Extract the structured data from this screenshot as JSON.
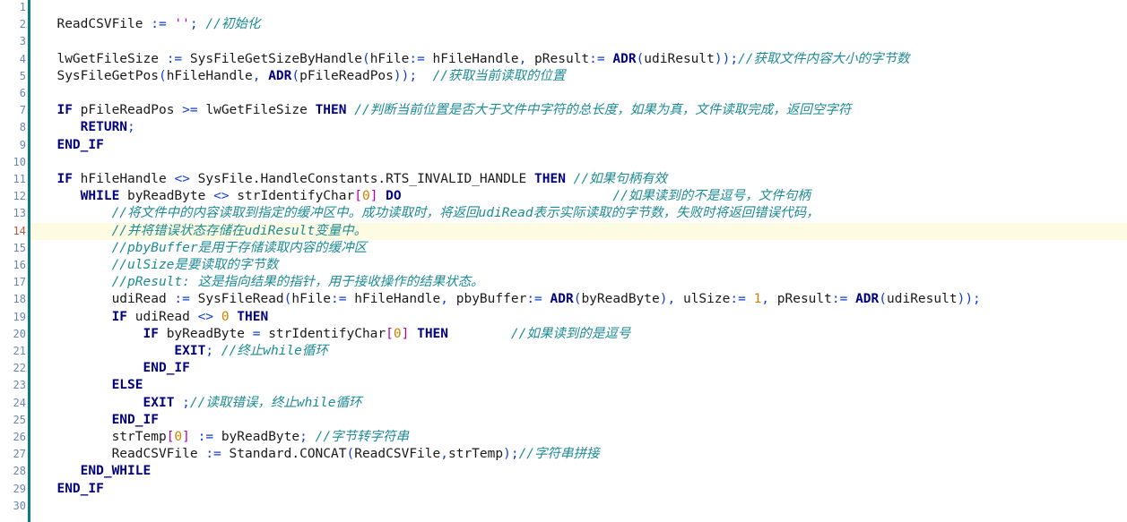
{
  "editor": {
    "title": "structured-text-code-editor",
    "language": "Structured Text (IEC 61131-3)",
    "current_line": 14,
    "first_visible_line": 1,
    "last_visible_line": 30,
    "colors": {
      "background": "#ffffff",
      "gutter_divider": "#0d7b80",
      "gutter_number": "#6b86b0",
      "gutter_number_current": "#b05a3c",
      "current_line_highlight": "#fdfbe2",
      "keyword": "#00007f",
      "comment": "#1d8a93",
      "operator": "#0f3fd0",
      "string": "#b000b0",
      "number": "#d08000",
      "bracket": "#b000b0",
      "identifier": "#1a1a1a"
    }
  },
  "gutter": {
    "numbers": [
      "1",
      "2",
      "3",
      "4",
      "5",
      "6",
      "7",
      "8",
      "9",
      "10",
      "11",
      "12",
      "13",
      "14",
      "15",
      "16",
      "17",
      "18",
      "19",
      "20",
      "21",
      "22",
      "23",
      "24",
      "25",
      "26",
      "27",
      "28",
      "29",
      "30"
    ]
  },
  "lines": [
    {
      "n": 1,
      "tokens": []
    },
    {
      "n": 2,
      "tokens": [
        {
          "t": "plain",
          "v": "  ReadCSVFile "
        },
        {
          "t": "op",
          "v": ":="
        },
        {
          "t": "plain",
          "v": " "
        },
        {
          "t": "str",
          "v": "''"
        },
        {
          "t": "punc",
          "v": ";"
        },
        {
          "t": "plain",
          "v": " "
        },
        {
          "t": "cmt",
          "v": "//初始化"
        }
      ]
    },
    {
      "n": 3,
      "tokens": []
    },
    {
      "n": 4,
      "tokens": [
        {
          "t": "plain",
          "v": "  lwGetFileSize "
        },
        {
          "t": "op",
          "v": ":="
        },
        {
          "t": "plain",
          "v": " SysFileGetSizeByHandle"
        },
        {
          "t": "punc",
          "v": "("
        },
        {
          "t": "plain",
          "v": "hFile"
        },
        {
          "t": "op",
          "v": ":="
        },
        {
          "t": "plain",
          "v": " hFileHandle"
        },
        {
          "t": "punc",
          "v": ", "
        },
        {
          "t": "plain",
          "v": "pResult"
        },
        {
          "t": "op",
          "v": ":="
        },
        {
          "t": "plain",
          "v": " "
        },
        {
          "t": "kw",
          "v": "ADR"
        },
        {
          "t": "punc",
          "v": "("
        },
        {
          "t": "plain",
          "v": "udiResult"
        },
        {
          "t": "punc",
          "v": "));"
        },
        {
          "t": "cmt",
          "v": "//获取文件内容大小的字节数"
        }
      ]
    },
    {
      "n": 5,
      "tokens": [
        {
          "t": "plain",
          "v": "  SysFileGetPos"
        },
        {
          "t": "punc",
          "v": "("
        },
        {
          "t": "plain",
          "v": "hFileHandle"
        },
        {
          "t": "punc",
          "v": ", "
        },
        {
          "t": "kw",
          "v": "ADR"
        },
        {
          "t": "punc",
          "v": "("
        },
        {
          "t": "plain",
          "v": "pFileReadPos"
        },
        {
          "t": "punc",
          "v": "));"
        },
        {
          "t": "plain",
          "v": "  "
        },
        {
          "t": "cmt",
          "v": "//获取当前读取的位置"
        }
      ]
    },
    {
      "n": 6,
      "tokens": []
    },
    {
      "n": 7,
      "tokens": [
        {
          "t": "plain",
          "v": "  "
        },
        {
          "t": "kw",
          "v": "IF"
        },
        {
          "t": "plain",
          "v": " pFileReadPos "
        },
        {
          "t": "op",
          "v": ">="
        },
        {
          "t": "plain",
          "v": " lwGetFileSize "
        },
        {
          "t": "kw",
          "v": "THEN"
        },
        {
          "t": "plain",
          "v": " "
        },
        {
          "t": "cmt",
          "v": "//判断当前位置是否大于文件中字符的总长度，如果为真，文件读取完成，返回空字符"
        }
      ]
    },
    {
      "n": 8,
      "tokens": [
        {
          "t": "plain",
          "v": "     "
        },
        {
          "t": "kw",
          "v": "RETURN"
        },
        {
          "t": "punc",
          "v": ";"
        }
      ]
    },
    {
      "n": 9,
      "tokens": [
        {
          "t": "plain",
          "v": "  "
        },
        {
          "t": "kw",
          "v": "END_IF"
        }
      ]
    },
    {
      "n": 10,
      "tokens": []
    },
    {
      "n": 11,
      "tokens": [
        {
          "t": "plain",
          "v": "  "
        },
        {
          "t": "kw",
          "v": "IF"
        },
        {
          "t": "plain",
          "v": " hFileHandle "
        },
        {
          "t": "op",
          "v": "<>"
        },
        {
          "t": "plain",
          "v": " SysFile.HandleConstants.RTS_INVALID_HANDLE "
        },
        {
          "t": "kw",
          "v": "THEN"
        },
        {
          "t": "plain",
          "v": " "
        },
        {
          "t": "cmt",
          "v": "//如果句柄有效"
        }
      ]
    },
    {
      "n": 12,
      "tokens": [
        {
          "t": "plain",
          "v": "     "
        },
        {
          "t": "kw",
          "v": "WHILE"
        },
        {
          "t": "plain",
          "v": " byReadByte "
        },
        {
          "t": "op",
          "v": "<>"
        },
        {
          "t": "plain",
          "v": " strIdentifyChar"
        },
        {
          "t": "brk",
          "v": "["
        },
        {
          "t": "num",
          "v": "0"
        },
        {
          "t": "brk",
          "v": "]"
        },
        {
          "t": "plain",
          "v": " "
        },
        {
          "t": "kw",
          "v": "DO"
        },
        {
          "t": "plain",
          "v": "                           "
        },
        {
          "t": "cmt",
          "v": "//如果读到的不是逗号，文件句柄"
        }
      ]
    },
    {
      "n": 13,
      "tokens": [
        {
          "t": "plain",
          "v": "         "
        },
        {
          "t": "cmt",
          "v": "//将文件中的内容读取到指定的缓冲区中。成功读取时，将返回udiRead表示实际读取的字节数，失败时将返回错误代码，"
        }
      ]
    },
    {
      "n": 14,
      "tokens": [
        {
          "t": "plain",
          "v": "         "
        },
        {
          "t": "cmt",
          "v": "//并将错误状态存储在udiResult变量中。"
        }
      ]
    },
    {
      "n": 15,
      "tokens": [
        {
          "t": "plain",
          "v": "         "
        },
        {
          "t": "cmt",
          "v": "//pbyBuffer是用于存储读取内容的缓冲区"
        }
      ]
    },
    {
      "n": 16,
      "tokens": [
        {
          "t": "plain",
          "v": "         "
        },
        {
          "t": "cmt",
          "v": "//ulSize是要读取的字节数"
        }
      ]
    },
    {
      "n": 17,
      "tokens": [
        {
          "t": "plain",
          "v": "         "
        },
        {
          "t": "cmt",
          "v": "//pResult: 这是指向结果的指针，用于接收操作的结果状态。"
        }
      ]
    },
    {
      "n": 18,
      "tokens": [
        {
          "t": "plain",
          "v": "         udiRead "
        },
        {
          "t": "op",
          "v": ":="
        },
        {
          "t": "plain",
          "v": " SysFileRead"
        },
        {
          "t": "punc",
          "v": "("
        },
        {
          "t": "plain",
          "v": "hFile"
        },
        {
          "t": "op",
          "v": ":="
        },
        {
          "t": "plain",
          "v": " hFileHandle"
        },
        {
          "t": "punc",
          "v": ", "
        },
        {
          "t": "plain",
          "v": "pbyBuffer"
        },
        {
          "t": "op",
          "v": ":="
        },
        {
          "t": "plain",
          "v": " "
        },
        {
          "t": "kw",
          "v": "ADR"
        },
        {
          "t": "punc",
          "v": "("
        },
        {
          "t": "plain",
          "v": "byReadByte"
        },
        {
          "t": "punc",
          "v": "), "
        },
        {
          "t": "plain",
          "v": "ulSize"
        },
        {
          "t": "op",
          "v": ":="
        },
        {
          "t": "plain",
          "v": " "
        },
        {
          "t": "num",
          "v": "1"
        },
        {
          "t": "punc",
          "v": ", "
        },
        {
          "t": "plain",
          "v": "pResult"
        },
        {
          "t": "op",
          "v": ":="
        },
        {
          "t": "plain",
          "v": " "
        },
        {
          "t": "kw",
          "v": "ADR"
        },
        {
          "t": "punc",
          "v": "("
        },
        {
          "t": "plain",
          "v": "udiResult"
        },
        {
          "t": "punc",
          "v": "));"
        }
      ]
    },
    {
      "n": 19,
      "tokens": [
        {
          "t": "plain",
          "v": "         "
        },
        {
          "t": "kw",
          "v": "IF"
        },
        {
          "t": "plain",
          "v": " udiRead "
        },
        {
          "t": "op",
          "v": "<>"
        },
        {
          "t": "plain",
          "v": " "
        },
        {
          "t": "num",
          "v": "0"
        },
        {
          "t": "plain",
          "v": " "
        },
        {
          "t": "kw",
          "v": "THEN"
        }
      ]
    },
    {
      "n": 20,
      "tokens": [
        {
          "t": "plain",
          "v": "             "
        },
        {
          "t": "kw",
          "v": "IF"
        },
        {
          "t": "plain",
          "v": " byReadByte "
        },
        {
          "t": "op",
          "v": "="
        },
        {
          "t": "plain",
          "v": " strIdentifyChar"
        },
        {
          "t": "brk",
          "v": "["
        },
        {
          "t": "num",
          "v": "0"
        },
        {
          "t": "brk",
          "v": "]"
        },
        {
          "t": "plain",
          "v": " "
        },
        {
          "t": "kw",
          "v": "THEN"
        },
        {
          "t": "plain",
          "v": "        "
        },
        {
          "t": "cmt",
          "v": "//如果读到的是逗号"
        }
      ]
    },
    {
      "n": 21,
      "tokens": [
        {
          "t": "plain",
          "v": "                 "
        },
        {
          "t": "kw",
          "v": "EXIT"
        },
        {
          "t": "punc",
          "v": ";"
        },
        {
          "t": "plain",
          "v": " "
        },
        {
          "t": "cmt",
          "v": "//终止while循环"
        }
      ]
    },
    {
      "n": 22,
      "tokens": [
        {
          "t": "plain",
          "v": "             "
        },
        {
          "t": "kw",
          "v": "END_IF"
        }
      ]
    },
    {
      "n": 23,
      "tokens": [
        {
          "t": "plain",
          "v": "         "
        },
        {
          "t": "kw",
          "v": "ELSE"
        }
      ]
    },
    {
      "n": 24,
      "tokens": [
        {
          "t": "plain",
          "v": "             "
        },
        {
          "t": "kw",
          "v": "EXIT"
        },
        {
          "t": "plain",
          "v": " "
        },
        {
          "t": "punc",
          "v": ";"
        },
        {
          "t": "cmt",
          "v": "//读取错误，终止while循环"
        }
      ]
    },
    {
      "n": 25,
      "tokens": [
        {
          "t": "plain",
          "v": "         "
        },
        {
          "t": "kw",
          "v": "END_IF"
        }
      ]
    },
    {
      "n": 26,
      "tokens": [
        {
          "t": "plain",
          "v": "         strTemp"
        },
        {
          "t": "brk",
          "v": "["
        },
        {
          "t": "num",
          "v": "0"
        },
        {
          "t": "brk",
          "v": "]"
        },
        {
          "t": "plain",
          "v": " "
        },
        {
          "t": "op",
          "v": ":="
        },
        {
          "t": "plain",
          "v": " byReadByte"
        },
        {
          "t": "punc",
          "v": ";"
        },
        {
          "t": "plain",
          "v": " "
        },
        {
          "t": "cmt",
          "v": "//字节转字符串"
        }
      ]
    },
    {
      "n": 27,
      "tokens": [
        {
          "t": "plain",
          "v": "         ReadCSVFile "
        },
        {
          "t": "op",
          "v": ":="
        },
        {
          "t": "plain",
          "v": " Standard.CONCAT"
        },
        {
          "t": "punc",
          "v": "("
        },
        {
          "t": "plain",
          "v": "ReadCSVFile"
        },
        {
          "t": "punc",
          "v": ","
        },
        {
          "t": "plain",
          "v": "strTemp"
        },
        {
          "t": "punc",
          "v": ");"
        },
        {
          "t": "cmt",
          "v": "//字符串拼接"
        }
      ]
    },
    {
      "n": 28,
      "tokens": [
        {
          "t": "plain",
          "v": "     "
        },
        {
          "t": "kw",
          "v": "END_WHILE"
        }
      ]
    },
    {
      "n": 29,
      "tokens": [
        {
          "t": "plain",
          "v": "  "
        },
        {
          "t": "kw",
          "v": "END_IF"
        }
      ]
    },
    {
      "n": 30,
      "tokens": []
    }
  ]
}
